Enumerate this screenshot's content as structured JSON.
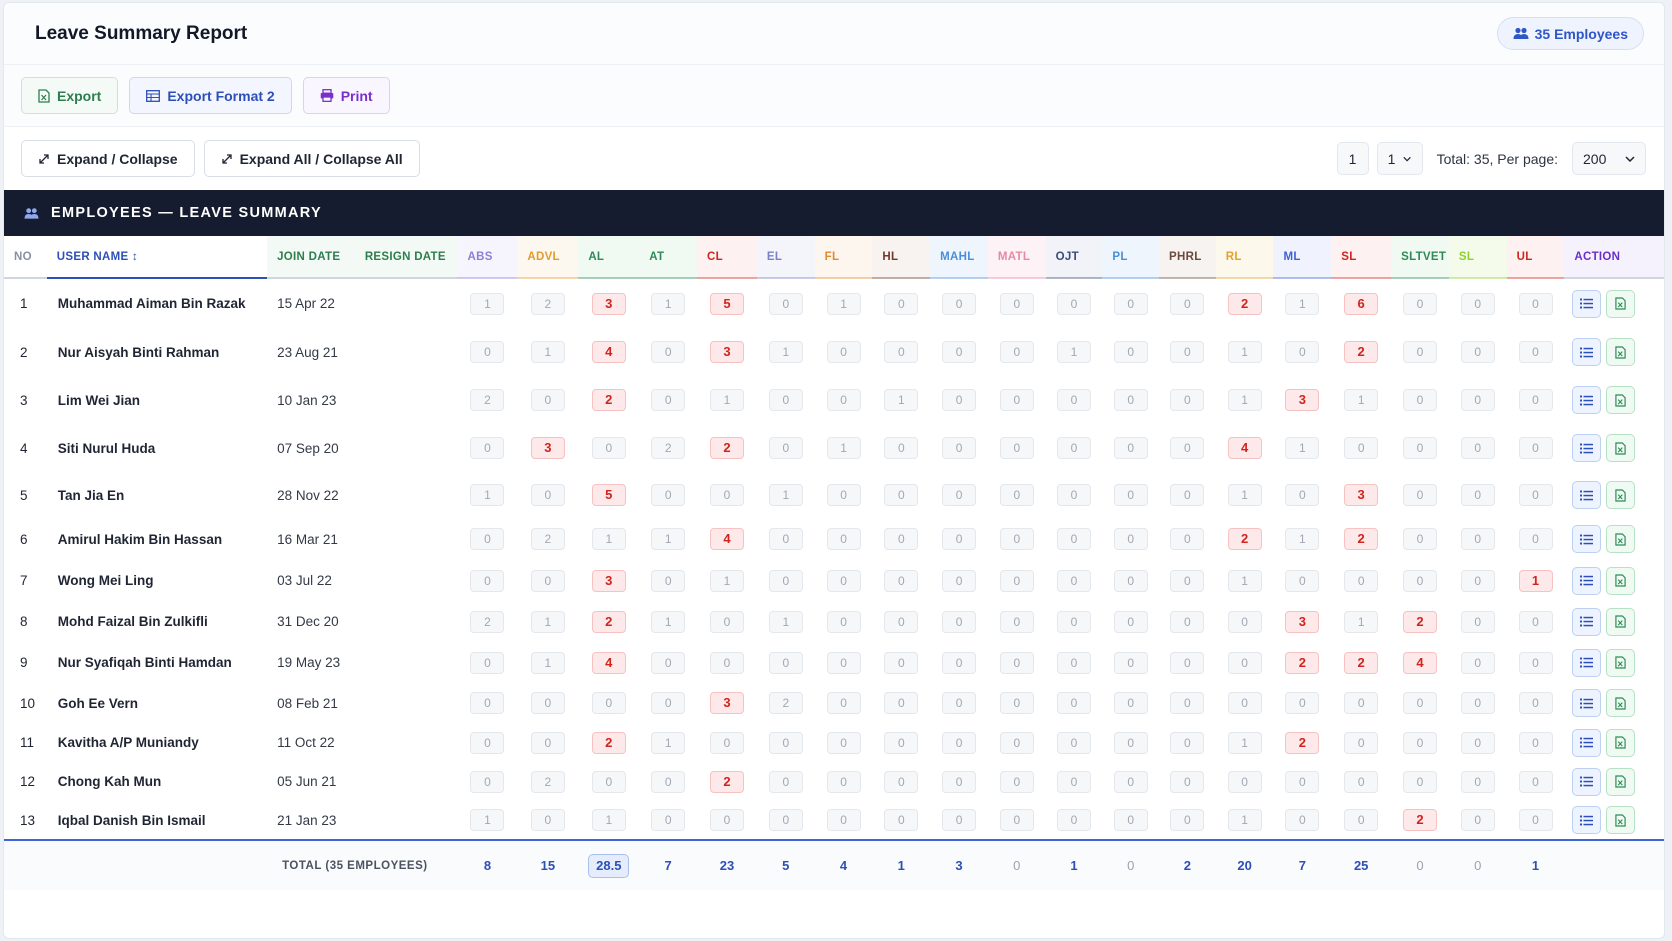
{
  "header": {
    "title": "Leave Summary Report",
    "employee_count_label": "35 Employees"
  },
  "toolbar": {
    "export_label": "Export",
    "export_format2_label": "Export Format 2",
    "print_label": "Print",
    "expand_collapse_label": "Expand / Collapse",
    "expand_all_label": "Expand All / Collapse All"
  },
  "pagination": {
    "current_page": "1",
    "page_select": "1",
    "total_text": "Total: 35, Per page:",
    "per_page": "200"
  },
  "section": {
    "title": "EMPLOYEES — LEAVE SUMMARY"
  },
  "colors": {
    "dark_header": "#151c2f",
    "accent_blue": "#2d4fb6",
    "highlight_red": "#d0251f"
  },
  "table": {
    "columns": [
      {
        "key": "no",
        "label": "NO",
        "color": "#8a90a0"
      },
      {
        "key": "name",
        "label": "USER NAME ↕",
        "color": "#2d4fb6"
      },
      {
        "key": "join",
        "label": "JOIN DATE",
        "color": "#2e7d4f"
      },
      {
        "key": "resign",
        "label": "RESIGN DATE",
        "color": "#2e7d4f"
      },
      {
        "key": "ABS",
        "label": "ABS",
        "color": "#8b7fd6"
      },
      {
        "key": "ADVL",
        "label": "ADVL",
        "color": "#e39b2d"
      },
      {
        "key": "AL",
        "label": "AL",
        "color": "#2e8b57"
      },
      {
        "key": "AT",
        "label": "AT",
        "color": "#2e8b57"
      },
      {
        "key": "CL",
        "label": "CL",
        "color": "#d0251f"
      },
      {
        "key": "EL",
        "label": "EL",
        "color": "#7a80c9"
      },
      {
        "key": "FL",
        "label": "FL",
        "color": "#e3892d"
      },
      {
        "key": "HL",
        "label": "HL",
        "color": "#6b3a2a"
      },
      {
        "key": "MAHL",
        "label": "MAHL",
        "color": "#4a8fd6"
      },
      {
        "key": "MATL",
        "label": "MATL",
        "color": "#e58aa3"
      },
      {
        "key": "OJT",
        "label": "OJT",
        "color": "#3b4a78"
      },
      {
        "key": "PL",
        "label": "PL",
        "color": "#4a8fd6"
      },
      {
        "key": "PHRL",
        "label": "PHRL",
        "color": "#6b4a3a"
      },
      {
        "key": "RL",
        "label": "RL",
        "color": "#e3a12d"
      },
      {
        "key": "ML",
        "label": "ML",
        "color": "#3e5fd6"
      },
      {
        "key": "SL",
        "label": "SL",
        "color": "#d0251f"
      },
      {
        "key": "SLTVET",
        "label": "SLTVET",
        "color": "#2e8b57"
      },
      {
        "key": "SL2",
        "label": "SL",
        "color": "#8fd12e"
      },
      {
        "key": "UL",
        "label": "UL",
        "color": "#d0251f"
      },
      {
        "key": "action",
        "label": "ACTION",
        "color": "#6a2fc9"
      }
    ],
    "rows": [
      {
        "no": "1",
        "name": "Muhammad Aiman Bin Razak",
        "join": "15 Apr 22",
        "resign": "",
        "counts": [
          1,
          2,
          3,
          1,
          5,
          0,
          1,
          0,
          0,
          0,
          0,
          0,
          0,
          2,
          1,
          6,
          0,
          0,
          0
        ]
      },
      {
        "no": "2",
        "name": "Nur Aisyah Binti Rahman",
        "join": "23 Aug 21",
        "resign": "",
        "counts": [
          0,
          1,
          4,
          0,
          3,
          1,
          0,
          0,
          0,
          0,
          1,
          0,
          0,
          1,
          0,
          2,
          0,
          0,
          0
        ]
      },
      {
        "no": "3",
        "name": "Lim Wei Jian",
        "join": "10 Jan 23",
        "resign": "",
        "counts": [
          2,
          0,
          2,
          0,
          1,
          0,
          0,
          1,
          0,
          0,
          0,
          0,
          0,
          1,
          3,
          1,
          0,
          0,
          0
        ]
      },
      {
        "no": "4",
        "name": "Siti Nurul Huda",
        "join": "07 Sep 20",
        "resign": "",
        "counts": [
          0,
          3,
          0,
          2,
          2,
          0,
          1,
          0,
          0,
          0,
          0,
          0,
          0,
          4,
          1,
          0,
          0,
          0,
          0
        ]
      },
      {
        "no": "5",
        "name": "Tan Jia En",
        "join": "28 Nov 22",
        "resign": "",
        "counts": [
          1,
          0,
          5,
          0,
          0,
          1,
          0,
          0,
          0,
          0,
          0,
          0,
          0,
          1,
          0,
          3,
          0,
          0,
          0
        ]
      },
      {
        "no": "6",
        "name": "Amirul Hakim Bin Hassan",
        "join": "16 Mar 21",
        "resign": "",
        "counts": [
          0,
          2,
          1,
          1,
          4,
          0,
          0,
          0,
          0,
          0,
          0,
          0,
          0,
          2,
          1,
          2,
          0,
          0,
          0
        ]
      },
      {
        "no": "7",
        "name": "Wong Mei Ling",
        "join": "03 Jul 22",
        "resign": "",
        "counts": [
          0,
          0,
          3,
          0,
          1,
          0,
          0,
          0,
          0,
          0,
          0,
          0,
          0,
          1,
          0,
          0,
          0,
          0,
          1
        ]
      },
      {
        "no": "8",
        "name": "Mohd Faizal Bin Zulkifli",
        "join": "31 Dec 20",
        "resign": "",
        "counts": [
          2,
          1,
          2,
          1,
          0,
          1,
          0,
          0,
          0,
          0,
          0,
          0,
          0,
          0,
          3,
          1,
          2,
          0,
          0
        ]
      },
      {
        "no": "9",
        "name": "Nur Syafiqah Binti Hamdan",
        "join": "19 May 23",
        "resign": "",
        "counts": [
          0,
          1,
          4,
          0,
          0,
          0,
          0,
          0,
          0,
          0,
          0,
          0,
          0,
          0,
          2,
          2,
          4,
          0,
          0
        ]
      },
      {
        "no": "10",
        "name": "Goh Ee Vern",
        "join": "08 Feb 21",
        "resign": "",
        "counts": [
          0,
          0,
          0,
          0,
          3,
          2,
          0,
          0,
          0,
          0,
          0,
          0,
          0,
          0,
          0,
          0,
          0,
          0,
          0
        ]
      },
      {
        "no": "11",
        "name": "Kavitha A/P Muniandy",
        "join": "11 Oct 22",
        "resign": "",
        "counts": [
          0,
          0,
          2,
          1,
          0,
          0,
          0,
          0,
          0,
          0,
          0,
          0,
          0,
          1,
          2,
          0,
          0,
          0,
          0
        ]
      },
      {
        "no": "12",
        "name": "Chong Kah Mun",
        "join": "05 Jun 21",
        "resign": "",
        "counts": [
          0,
          2,
          0,
          0,
          2,
          0,
          0,
          0,
          0,
          0,
          0,
          0,
          0,
          0,
          0,
          0,
          0,
          0,
          0
        ]
      },
      {
        "no": "13",
        "name": "Iqbal Danish Bin Ismail",
        "join": "21 Jan 23",
        "resign": "",
        "counts": [
          1,
          0,
          1,
          0,
          0,
          0,
          0,
          0,
          0,
          0,
          0,
          0,
          0,
          1,
          0,
          0,
          2,
          0,
          0
        ]
      }
    ],
    "highlights": [
      [
        2,
        4,
        13,
        15
      ],
      [
        2,
        4,
        15
      ],
      [
        2,
        14
      ],
      [
        1,
        4,
        13
      ],
      [
        2,
        15
      ],
      [
        4,
        13,
        15
      ],
      [
        2,
        18
      ],
      [
        2,
        14,
        16
      ],
      [
        2,
        14,
        15,
        16
      ],
      [
        4
      ],
      [
        2,
        14
      ],
      [
        4
      ],
      [
        16
      ]
    ],
    "footer": {
      "label": "TOTAL (35 EMPLOYEES)",
      "totals": [
        "8",
        "15",
        "28.5",
        "7",
        "23",
        "5",
        "4",
        "1",
        "3",
        "0",
        "1",
        "0",
        "2",
        "20",
        "7",
        "25",
        "0",
        "0",
        "1"
      ],
      "highlight_index": 2
    }
  }
}
